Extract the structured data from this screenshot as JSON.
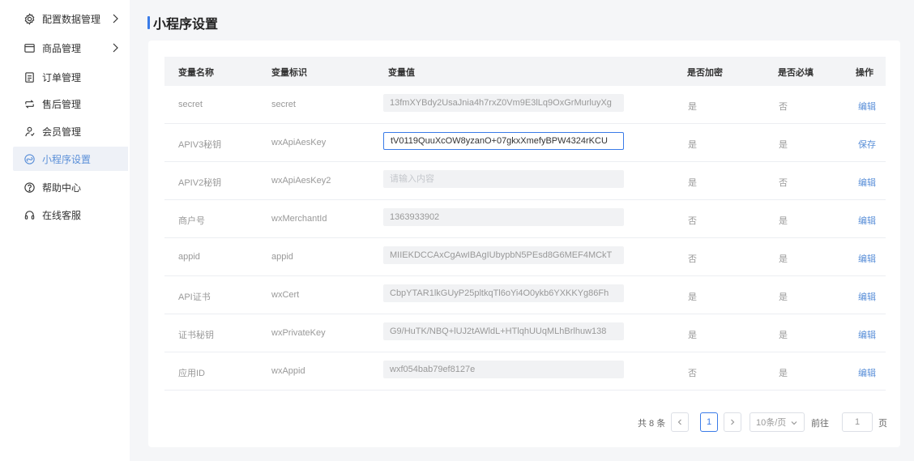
{
  "sidebar": {
    "items": [
      {
        "label": "配置数据管理",
        "icon": "gear-icon",
        "has_arrow": true,
        "active": false
      },
      {
        "label": "商品管理",
        "icon": "box-icon",
        "has_arrow": true,
        "active": false
      },
      {
        "label": "订单管理",
        "icon": "order-icon",
        "has_arrow": false,
        "active": false
      },
      {
        "label": "售后管理",
        "icon": "aftersale-icon",
        "has_arrow": false,
        "active": false
      },
      {
        "label": "会员管理",
        "icon": "member-icon",
        "has_arrow": false,
        "active": false
      },
      {
        "label": "小程序设置",
        "icon": "miniapp-icon",
        "has_arrow": false,
        "active": true
      },
      {
        "label": "帮助中心",
        "icon": "help-icon",
        "has_arrow": false,
        "active": false
      },
      {
        "label": "在线客服",
        "icon": "headset-icon",
        "has_arrow": false,
        "active": false
      }
    ]
  },
  "page": {
    "title": "小程序设置"
  },
  "table": {
    "headers": {
      "name": "变量名称",
      "key": "变量标识",
      "value": "变量值",
      "encrypted": "是否加密",
      "required": "是否必填",
      "action": "操作"
    },
    "rows": [
      {
        "name": "secret",
        "key": "secret",
        "value": "13fmXYBdy2UsaJnia4h7rxZ0Vm9E3lLq9OxGrMurluyXg",
        "encrypted": "是",
        "required": "否",
        "action": "编辑"
      },
      {
        "name": "APIV3秘钥",
        "key": "wxApiAesKey",
        "value": "tV0119QuuXcOW8yzanO+07gkxXmefyBPW4324rKCU",
        "encrypted": "是",
        "required": "是",
        "action": "保存"
      },
      {
        "name": "APIV2秘钥",
        "key": "wxApiAesKey2",
        "value": "",
        "placeholder": "请输入内容",
        "encrypted": "是",
        "required": "否",
        "action": "编辑"
      },
      {
        "name": "商户号",
        "key": "wxMerchantId",
        "value": "1363933902",
        "encrypted": "否",
        "required": "是",
        "action": "编辑"
      },
      {
        "name": "appid",
        "key": "appid",
        "value": "MIIEKDCCAxCgAwIBAgIUbypbN5PEsd8G6MEF4MCkT",
        "encrypted": "否",
        "required": "是",
        "action": "编辑"
      },
      {
        "name": "API证书",
        "key": "wxCert",
        "value": "CbpYTAR1lkGUyP25pltkqTl6oYi4O0ykb6YXKKYg86Fh",
        "encrypted": "是",
        "required": "是",
        "action": "编辑"
      },
      {
        "name": "证书秘钥",
        "key": "wxPrivateKey",
        "value": "G9/HuTK/NBQ+lUJ2tAWldL+HTlqhUUqMLhBrlhuw138",
        "encrypted": "是",
        "required": "是",
        "action": "编辑"
      },
      {
        "name": "应用ID",
        "key": "wxAppid",
        "value": "wxf054bab79ef8127e",
        "encrypted": "否",
        "required": "是",
        "action": "编辑"
      }
    ]
  },
  "pagination": {
    "total": "共 8 条",
    "current_page": "1",
    "page_size": "10条/页",
    "goto_label": "前往",
    "goto_value": "1",
    "page_unit": "页"
  },
  "colors": {
    "accent": "#3a7be8",
    "link": "#5a8fd8",
    "active_bg": "#eef1f7"
  }
}
